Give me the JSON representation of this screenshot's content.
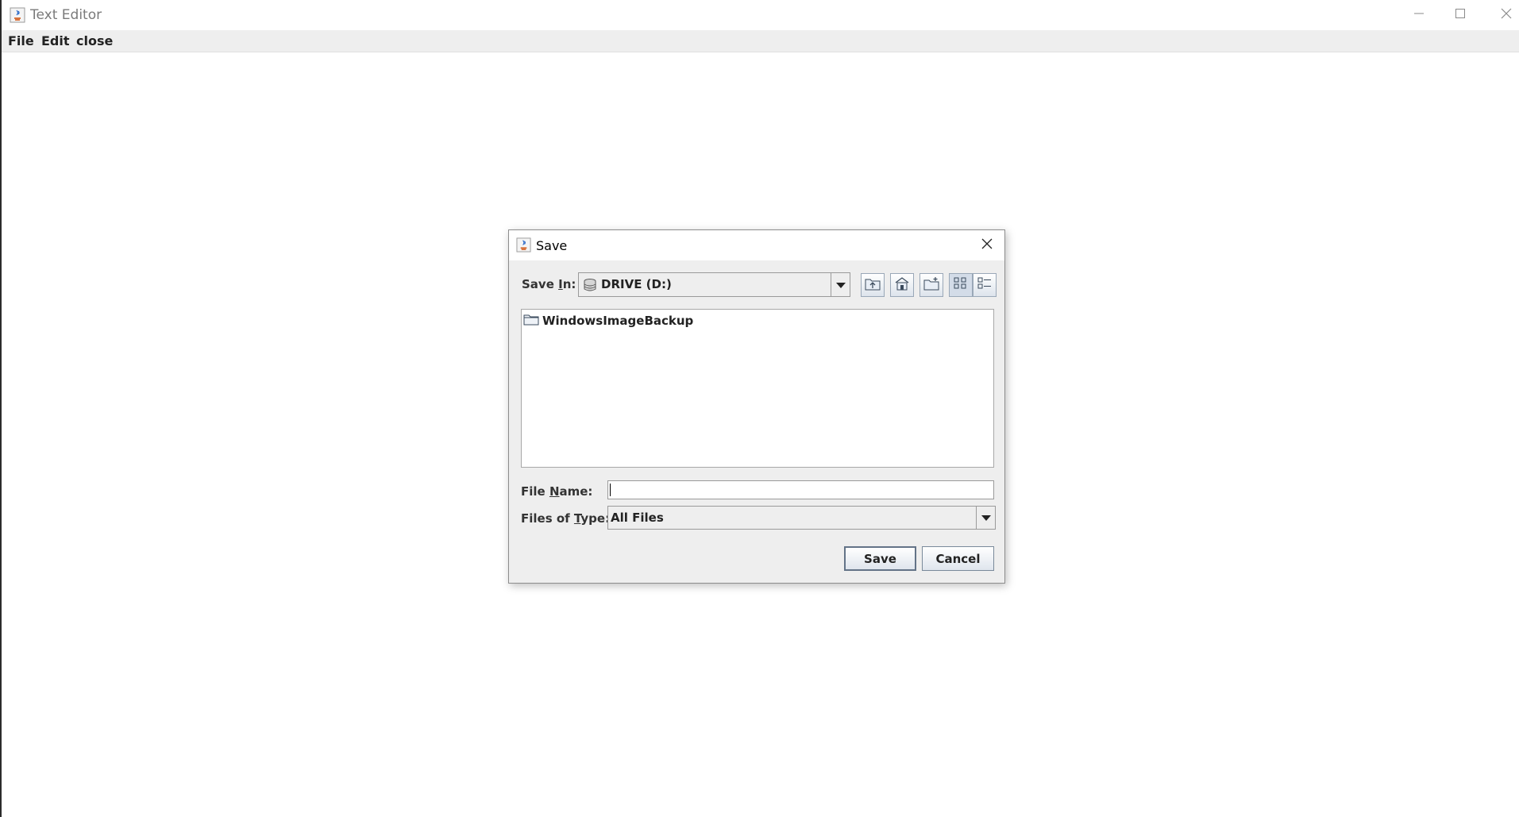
{
  "window": {
    "title": "Text Editor",
    "controls": {
      "minimize": "minimize-icon",
      "maximize": "maximize-icon",
      "close": "close-icon"
    }
  },
  "menubar": {
    "items": [
      {
        "label": "File"
      },
      {
        "label": "Edit"
      },
      {
        "label": "close"
      }
    ]
  },
  "dialog": {
    "title": "Save",
    "save_in": {
      "label_pre": "Save ",
      "label_mnemonic": "I",
      "label_post": "n:",
      "value": "DRIVE (D:)"
    },
    "toolbar": {
      "up_one_level": "up-folder-icon",
      "home": "home-icon",
      "new_folder": "new-folder-icon",
      "list_view": "list-view-icon",
      "details_view": "details-view-icon"
    },
    "files": [
      {
        "name": "WindowsImageBackup",
        "icon": "folder-icon"
      }
    ],
    "file_name": {
      "label_pre": "File ",
      "label_mnemonic": "N",
      "label_post": "ame:",
      "value": ""
    },
    "files_of_type": {
      "label_pre": "Files of ",
      "label_mnemonic": "T",
      "label_post": "ype:",
      "value": "All Files"
    },
    "buttons": {
      "save": "Save",
      "cancel": "Cancel"
    }
  },
  "colors": {
    "menubar_bg": "#eeeeee",
    "dialog_bg": "#eeeeee",
    "button_border": "#7a8a9a"
  }
}
